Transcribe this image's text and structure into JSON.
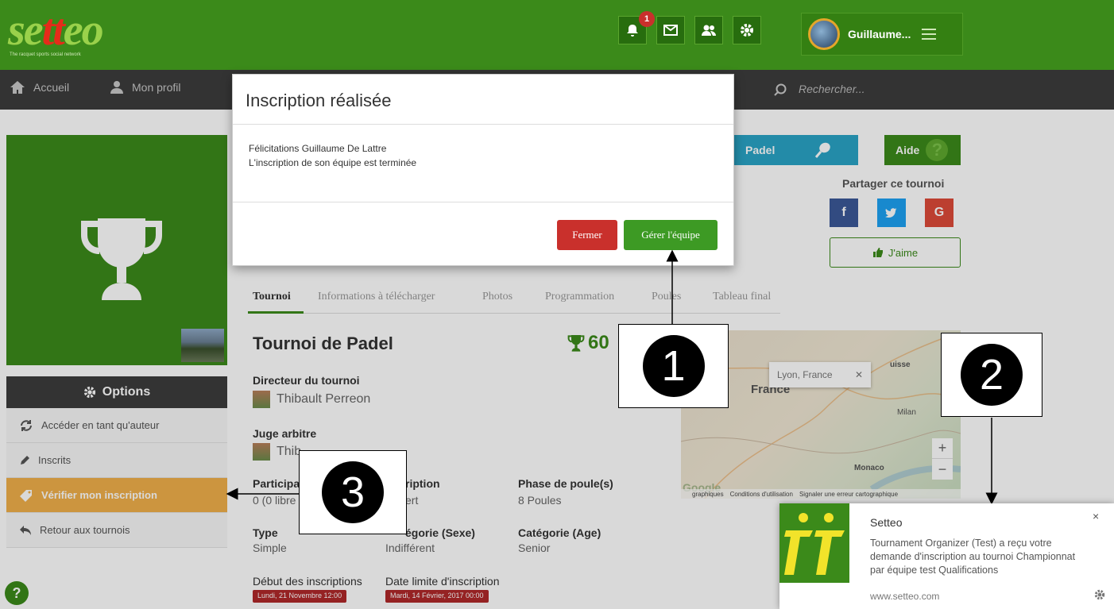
{
  "header": {
    "logo_text_a": "se",
    "logo_text_b": "tt",
    "logo_text_c": "eo",
    "logo_tagline": "The racquet sports social network",
    "notification_count": "1",
    "user_name": "Guillaume..."
  },
  "nav": {
    "home": "Accueil",
    "profile": "Mon profil",
    "search_placeholder": "Rechercher..."
  },
  "sidebar": {
    "options_label": "Options",
    "items": [
      {
        "label": "Accéder en tant qu'auteur"
      },
      {
        "label": "Inscrits"
      },
      {
        "label": "Vérifier mon inscription"
      },
      {
        "label": "Retour aux tournois"
      }
    ]
  },
  "modal": {
    "title": "Inscription réalisée",
    "line1": "Félicitations Guillaume De Lattre",
    "line2": "L'inscription de son équipe est terminée",
    "close_label": "Fermer",
    "manage_label": "Gérer l'équipe"
  },
  "sport": {
    "padel_label": "Padel",
    "help_label": "Aide",
    "share_label": "Partager ce tournoi",
    "share_fb": "f",
    "share_g": "G",
    "like_label": "J'aime"
  },
  "tabs": [
    "Tournoi",
    "Informations à télécharger",
    "Photos",
    "Programmation",
    "Poules",
    "Tableau final"
  ],
  "tournament": {
    "title": "Tournoi de Padel",
    "trophy_value": "60",
    "director_label": "Directeur du tournoi",
    "director_name": "Thibault Perreon",
    "judge_label": "Juge arbitre",
    "judge_name": "Thib",
    "participants_label": "Participa",
    "participants_value": "0 (0 libre",
    "inscription_label": "ription",
    "inscription_value": "ert",
    "pool_label": "Phase de poule(s)",
    "pool_value": "8 Poules",
    "type_label": "Type",
    "type_value": "Simple",
    "sex_label": "égorie (Sexe)",
    "sex_value": "Indifférent",
    "age_label": "Catégorie (Age)",
    "age_value": "Senior",
    "start_label": "Début des inscriptions",
    "start_value": "Lundi, 21 Novembre 12:00",
    "deadline_label": "Date limite d'inscription",
    "deadline_value": "Mardi, 14 Février, 2017 00:00"
  },
  "map": {
    "popup": "Lyon, France",
    "france": "France",
    "suisse": "uisse",
    "milan": "Milan",
    "monaco": "Monaco",
    "footer_a": "graphiques",
    "footer_b": "Conditions d'utilisation",
    "footer_c": "Signaler une erreur cartographique",
    "google": "Google"
  },
  "callouts": [
    "1",
    "2",
    "3"
  ],
  "toast": {
    "title": "Setteo",
    "message": "Tournament Organizer (Test) a reçu votre demande d'inscription au tournoi Championnat par équipe test Qualifications",
    "site": "www.setteo.com"
  },
  "colors": {
    "brand_green": "#3b8a1a",
    "danger": "#c9302c",
    "accent": "#f0b04a"
  }
}
